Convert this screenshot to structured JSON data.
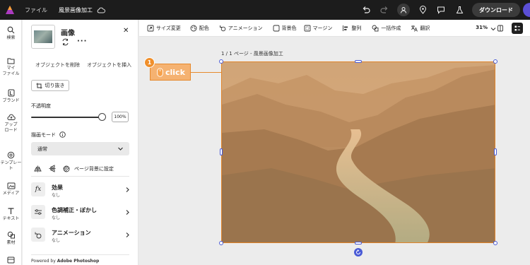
{
  "topbar": {
    "file_label": "ファイル",
    "doc_title": "風景画像加工",
    "download_label": "ダウンロード"
  },
  "rail": {
    "items": [
      {
        "label": "検索",
        "icon": "search-icon"
      },
      {
        "label": "マイ\nファイル",
        "icon": "folder-icon"
      },
      {
        "label": "ブランド",
        "icon": "brand-icon"
      },
      {
        "label": "アップ\nロード",
        "icon": "upload-icon"
      },
      {
        "label": "テンプレート",
        "icon": "template-icon"
      },
      {
        "label": "メディア",
        "icon": "media-icon"
      },
      {
        "label": "テキスト",
        "icon": "text-icon"
      },
      {
        "label": "素材",
        "icon": "elements-icon"
      }
    ]
  },
  "panel": {
    "title": "画像",
    "remove_bg": "オブジェクトを削除",
    "insert_object": "オブジェクトを挿入",
    "crop": "切り抜き",
    "opacity_label": "不透明度",
    "opacity_value": "100%",
    "blend_mode_label": "描画モード",
    "blend_mode_value": "通常",
    "page_bg": "ページ背景に設定",
    "rows": [
      {
        "title": "効果",
        "sub": "なし"
      },
      {
        "title": "色調補正・ぼかし",
        "sub": "なし"
      },
      {
        "title": "アニメーション",
        "sub": "なし"
      }
    ],
    "powered_prefix": "Powered by ",
    "powered_brand": "Adobe Photoshop"
  },
  "ctxbar": {
    "items": [
      "サイズ変更",
      "配色",
      "アニメーション",
      "背景色",
      "マージン",
      "整列",
      "一括作成",
      "翻訳"
    ],
    "zoom": "31%"
  },
  "canvas": {
    "page_label": "1 / 1 ページ - 風景画像加工"
  },
  "callout": {
    "badge": "1",
    "text": "click"
  },
  "colors": {
    "accent": "#e68a2e",
    "selection": "#4a5bd6",
    "topbar": "#1c1c1c"
  }
}
